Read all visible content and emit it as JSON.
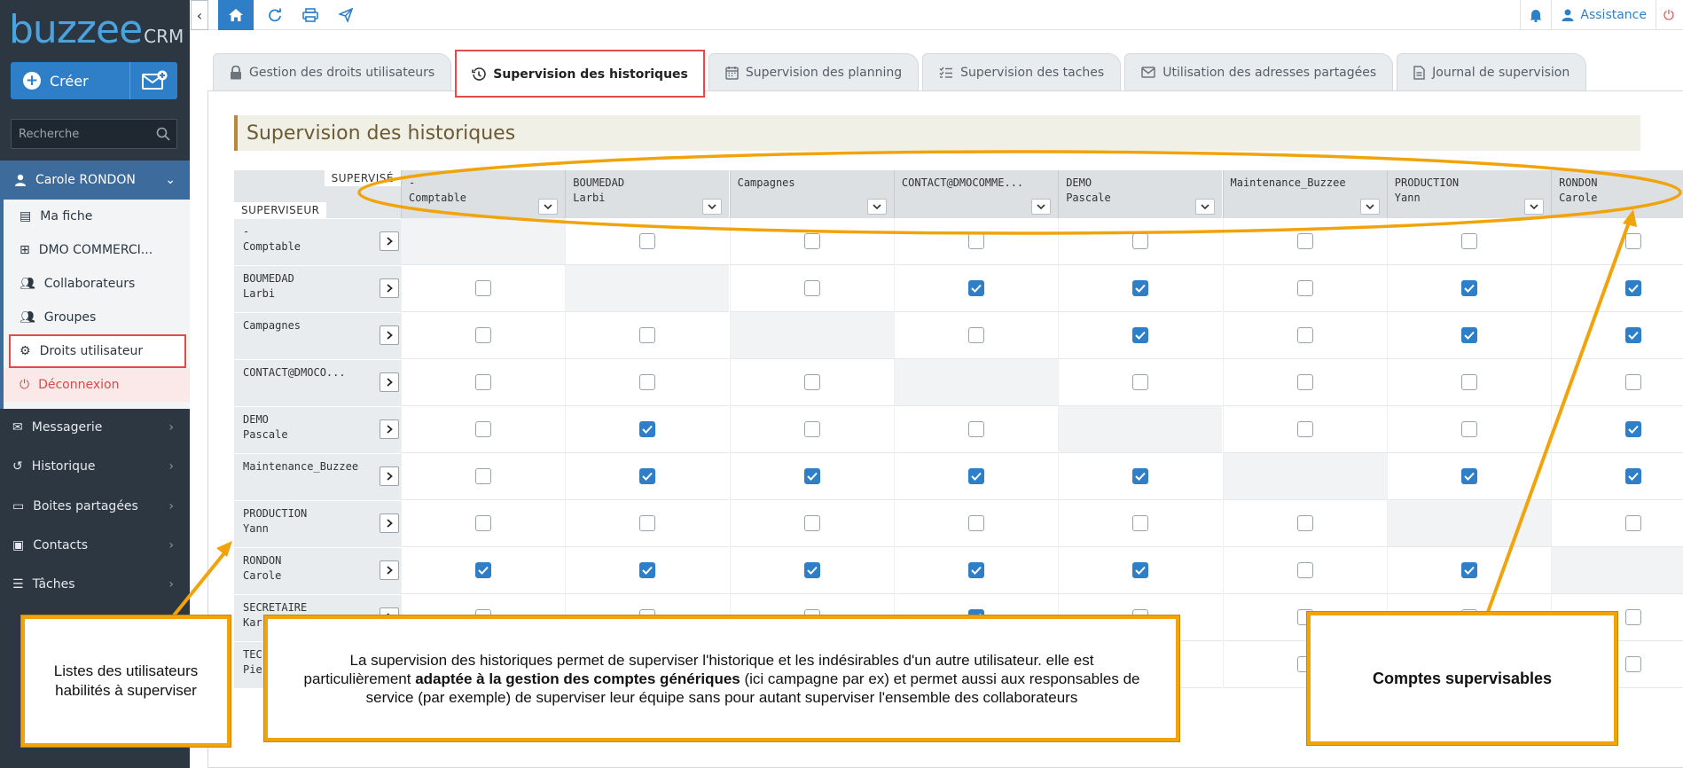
{
  "brand": {
    "logo_main": "buzzee",
    "logo_sub": "CRM"
  },
  "sidebar": {
    "create_label": "Créer",
    "search_placeholder": "Recherche",
    "user_name": "Carole RONDON",
    "submenu": [
      {
        "label": "Ma fiche",
        "icon": "contact-card-icon"
      },
      {
        "label": "DMO COMMERCI...",
        "icon": "org-chart-icon"
      },
      {
        "label": "Collaborateurs",
        "icon": "users-icon"
      },
      {
        "label": "Groupes",
        "icon": "group-icon"
      },
      {
        "label": "Droits utilisateur",
        "icon": "user-rights-icon"
      },
      {
        "label": "Déconnexion",
        "icon": "power-icon"
      }
    ],
    "nav": [
      {
        "label": "Messagerie",
        "icon": "mail-icon"
      },
      {
        "label": "Historique",
        "icon": "history-icon"
      },
      {
        "label": "Boites partagées",
        "icon": "folder-icon"
      },
      {
        "label": "Contacts",
        "icon": "contact-icon"
      },
      {
        "label": "Tâches",
        "icon": "tasks-icon"
      }
    ]
  },
  "topbar": {
    "assistance_label": "Assistance"
  },
  "tabs": [
    {
      "label": "Gestion des droits utilisateurs",
      "icon": "lock-icon",
      "active": false
    },
    {
      "label": "Supervision des historiques",
      "icon": "history-icon",
      "active": true
    },
    {
      "label": "Supervision des planning",
      "icon": "calendar-icon",
      "active": false
    },
    {
      "label": "Supervision des taches",
      "icon": "checklist-icon",
      "active": false
    },
    {
      "label": "Utilisation des adresses partagées",
      "icon": "envelope-icon",
      "active": false
    },
    {
      "label": "Journal de supervision",
      "icon": "document-icon",
      "active": false
    }
  ],
  "page_title": "Supervision des historiques",
  "matrix": {
    "corner_top": "SUPERVISÉ",
    "corner_bottom": "SUPERVISEUR",
    "columns": [
      {
        "l1": "-",
        "l2": "Comptable"
      },
      {
        "l1": "BOUMEDAD",
        "l2": "Larbi"
      },
      {
        "l1": "Campagnes",
        "l2": ""
      },
      {
        "l1": "CONTACT@DMOCOMME...",
        "l2": ""
      },
      {
        "l1": "DEMO",
        "l2": "Pascale"
      },
      {
        "l1": "Maintenance_Buzzee",
        "l2": ""
      },
      {
        "l1": "PRODUCTION",
        "l2": "Yann"
      },
      {
        "l1": "RONDON",
        "l2": "Carole"
      }
    ],
    "rows": [
      {
        "l1": "-",
        "l2": "Comptable",
        "checks": [
          null,
          0,
          0,
          0,
          0,
          0,
          0,
          0
        ]
      },
      {
        "l1": "BOUMEDAD",
        "l2": "Larbi",
        "checks": [
          0,
          null,
          0,
          1,
          1,
          0,
          1,
          1
        ]
      },
      {
        "l1": "Campagnes",
        "l2": "",
        "checks": [
          0,
          0,
          null,
          0,
          1,
          0,
          1,
          1
        ]
      },
      {
        "l1": "CONTACT@DMOCO...",
        "l2": "",
        "checks": [
          0,
          0,
          0,
          null,
          0,
          0,
          0,
          0
        ]
      },
      {
        "l1": "DEMO",
        "l2": "Pascale",
        "checks": [
          0,
          1,
          0,
          0,
          null,
          0,
          0,
          1
        ]
      },
      {
        "l1": "Maintenance_Buzzee",
        "l2": "",
        "checks": [
          0,
          1,
          1,
          1,
          1,
          null,
          1,
          1
        ]
      },
      {
        "l1": "PRODUCTION",
        "l2": "Yann",
        "checks": [
          0,
          0,
          0,
          0,
          0,
          0,
          null,
          0
        ]
      },
      {
        "l1": "RONDON",
        "l2": "Carole",
        "checks": [
          1,
          1,
          1,
          1,
          1,
          0,
          1,
          null
        ]
      },
      {
        "l1": "SECRETAIRE",
        "l2": "Kar",
        "checks": [
          0,
          0,
          0,
          1,
          0,
          0,
          0,
          0
        ]
      },
      {
        "l1": "TEC",
        "l2": "Pier",
        "checks": [
          0,
          0,
          0,
          0,
          0,
          0,
          0,
          0
        ]
      }
    ]
  },
  "annotations": {
    "left": "Listes des utilisateurs habilités à superviser",
    "center_part1": "La supervision des historiques permet de superviser l'historique et les indésirables d'un autre utilisateur. elle est particulièrement ",
    "center_bold": "adaptée à la gestion des comptes génériques",
    "center_part2": " (ici campagne par ex) et permet aussi aux responsables de service (par exemple) de superviser leur équipe sans pour autant superviser l'ensemble des collaborateurs",
    "right": "Comptes supervisables"
  },
  "colors": {
    "accent": "#2f7fc8",
    "sidebar": "#2c3742",
    "highlight": "#e34b4b",
    "callout_border": "#f0a30a"
  }
}
